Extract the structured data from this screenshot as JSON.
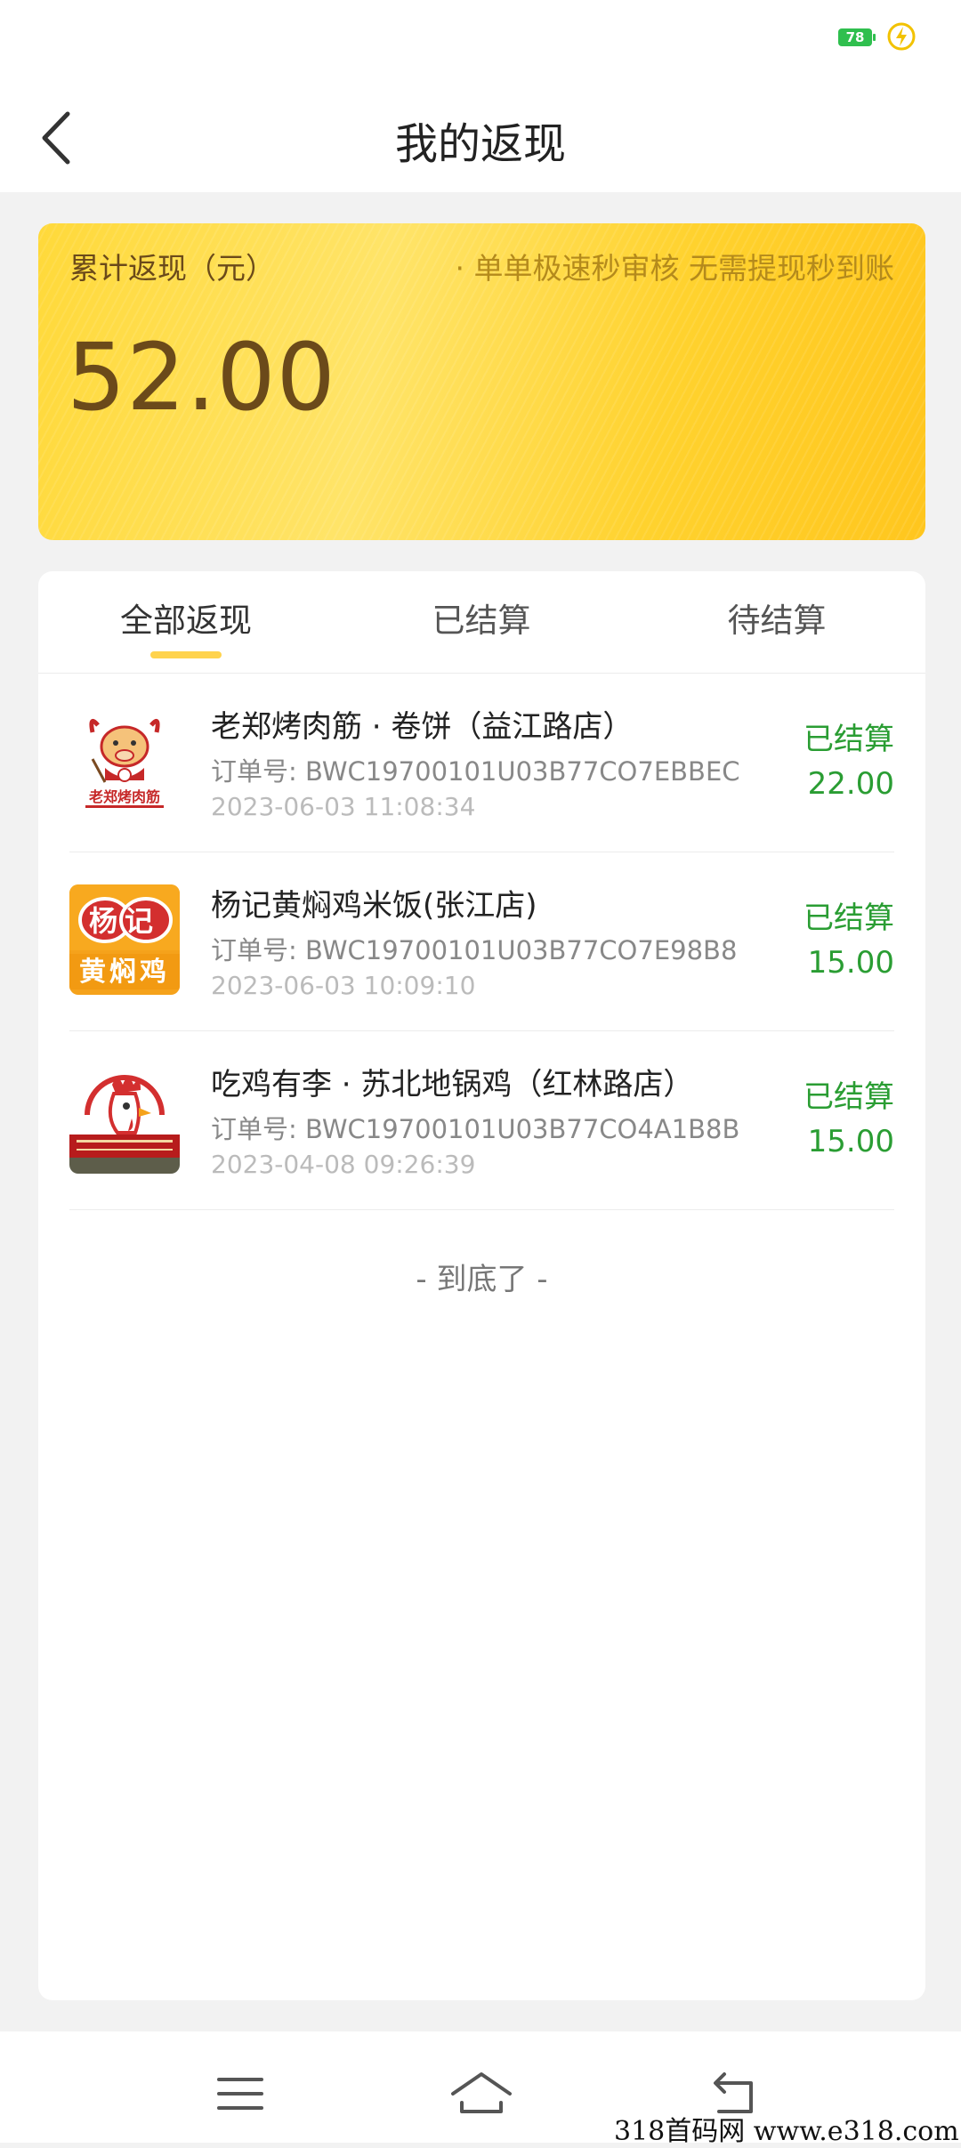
{
  "status_bar": {
    "battery": "78"
  },
  "header": {
    "title": "我的返现"
  },
  "summary": {
    "label": "累计返现（元）",
    "slogan": "· 单单极速秒审核 无需提现秒到账",
    "amount": "52.00"
  },
  "tabs": [
    {
      "label": "全部返现",
      "active": true
    },
    {
      "label": "已结算",
      "active": false
    },
    {
      "label": "待结算",
      "active": false
    }
  ],
  "orders": [
    {
      "shop": "老郑烤肉筋 · 卷饼（益江路店）",
      "order_no": "订单号: BWC19700101U03B77CO7EBBEC",
      "time": "2023-06-03 11:08:34",
      "status": "已结算",
      "amount": "22.00",
      "logo_text": "老郑烤肉筋",
      "logo_icon": "cartoon-cow-chef"
    },
    {
      "shop": "杨记黄焖鸡米饭(张江店)",
      "order_no": "订单号: BWC19700101U03B77CO7E98B8",
      "time": "2023-06-03 10:09:10",
      "status": "已结算",
      "amount": "15.00",
      "logo_text_top": "杨记",
      "logo_text_bottom": "黄焖鸡"
    },
    {
      "shop": "吃鸡有李 · 苏北地锅鸡（红林路店）",
      "order_no": "订单号: BWC19700101U03B77CO4A1B8B",
      "time": "2023-04-08 09:26:39",
      "status": "已结算",
      "amount": "15.00",
      "logo_icon": "rooster-head"
    }
  ],
  "end_text": "- 到底了 -",
  "watermark": "318首码网  www.e318.com",
  "colors": {
    "accent_yellow": "#ffd34d",
    "status_green": "#2a9d33",
    "amount_brown": "#6b4a1a"
  }
}
